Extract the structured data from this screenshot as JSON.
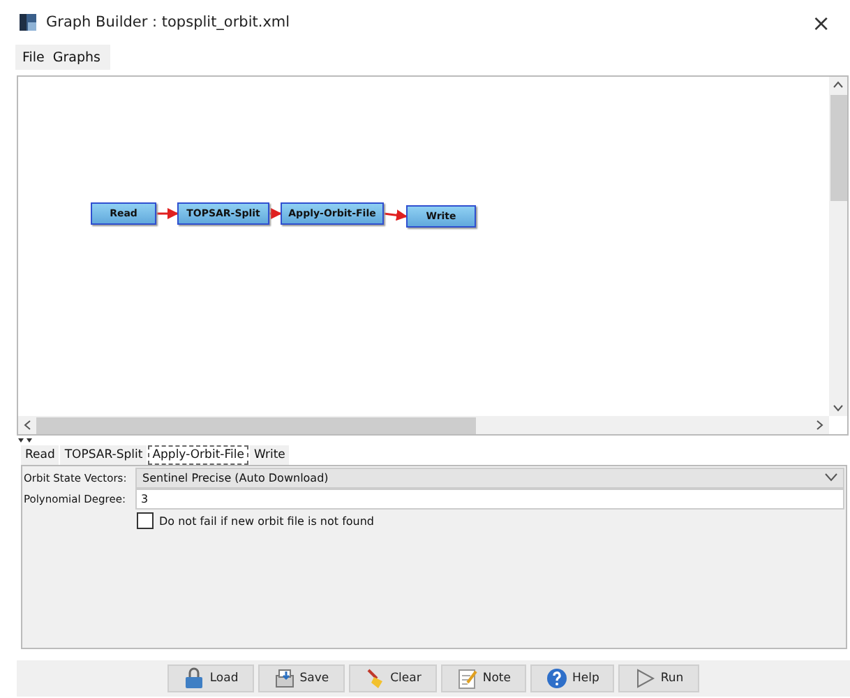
{
  "window": {
    "title": "Graph Builder : topsplit_orbit.xml",
    "close": "×"
  },
  "menu": [
    "File",
    "Graphs"
  ],
  "graph": {
    "nodes": [
      "Read",
      "TOPSAR-Split",
      "Apply-Orbit-File",
      "Write"
    ]
  },
  "tabs": [
    {
      "label": "Read",
      "selected": false
    },
    {
      "label": "TOPSAR-Split",
      "selected": false
    },
    {
      "label": "Apply-Orbit-File",
      "selected": true
    },
    {
      "label": "Write",
      "selected": false
    }
  ],
  "params": [
    {
      "kind": "dropdown",
      "label": "Orbit State Vectors:",
      "value": "Sentinel Precise (Auto Download)"
    },
    {
      "kind": "text",
      "label": "Polynomial Degree:",
      "value": "3"
    },
    {
      "kind": "checkbox",
      "label": "Do not fail if new orbit file is not found",
      "checked": false
    }
  ],
  "buttons": [
    {
      "kind": "load",
      "label": "Load"
    },
    {
      "kind": "save",
      "label": "Save"
    },
    {
      "kind": "clear",
      "label": "Clear"
    },
    {
      "kind": "note",
      "label": "Note"
    },
    {
      "kind": "help",
      "label": "Help"
    },
    {
      "kind": "run",
      "label": "Run"
    }
  ]
}
